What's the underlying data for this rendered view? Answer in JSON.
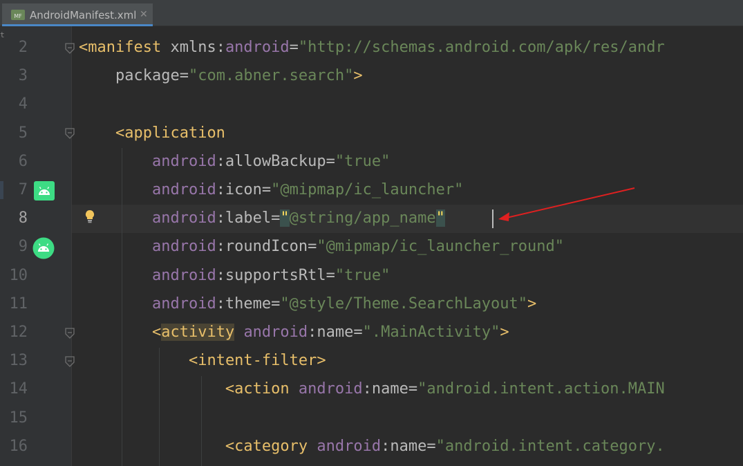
{
  "tab": {
    "icon_text": "MF",
    "label": "AndroidManifest.xml",
    "close": "✕"
  },
  "left_strip": {
    "glyph": "t"
  },
  "editor": {
    "top_fragment": "\"",
    "lines": [
      {
        "no": "2",
        "tokens": [
          {
            "c": "p",
            "t": "<"
          },
          {
            "c": "t",
            "t": "manifest"
          },
          {
            "c": "at",
            "t": " xmlns:"
          },
          {
            "c": "ns",
            "t": "android"
          },
          {
            "c": "at",
            "t": "="
          },
          {
            "c": "v",
            "t": "\"http://schemas.android.com/apk/res/andr"
          }
        ]
      },
      {
        "no": "3",
        "tokens": [
          {
            "c": "at",
            "t": "    package"
          },
          {
            "c": "at",
            "t": "="
          },
          {
            "c": "v",
            "t": "\"com.abner.search\""
          },
          {
            "c": "p",
            "t": ">"
          }
        ]
      },
      {
        "no": "4",
        "tokens": []
      },
      {
        "no": "5",
        "tokens": [
          {
            "c": "at",
            "t": "    "
          },
          {
            "c": "p",
            "t": "<"
          },
          {
            "c": "t",
            "t": "application"
          }
        ]
      },
      {
        "no": "6",
        "tokens": [
          {
            "c": "at",
            "t": "        "
          },
          {
            "c": "ns",
            "t": "android"
          },
          {
            "c": "at",
            "t": ":allowBackup="
          },
          {
            "c": "v",
            "t": "\"true\""
          }
        ]
      },
      {
        "no": "7",
        "tokens": [
          {
            "c": "at",
            "t": "        "
          },
          {
            "c": "ns",
            "t": "android"
          },
          {
            "c": "at",
            "t": ":icon="
          },
          {
            "c": "v",
            "t": "\"@mipmap/ic_launcher\""
          }
        ]
      },
      {
        "no": "8",
        "tokens": [
          {
            "c": "at",
            "t": "        "
          },
          {
            "c": "ns",
            "t": "android"
          },
          {
            "c": "at",
            "t": ":label="
          },
          {
            "c": "qm",
            "t": "\""
          },
          {
            "c": "v",
            "t": "@string/app_name"
          },
          {
            "c": "qm",
            "t": "\""
          }
        ]
      },
      {
        "no": "9",
        "tokens": [
          {
            "c": "at",
            "t": "        "
          },
          {
            "c": "ns",
            "t": "android"
          },
          {
            "c": "at",
            "t": ":roundIcon="
          },
          {
            "c": "v",
            "t": "\"@mipmap/ic_launcher_round\""
          }
        ]
      },
      {
        "no": "10",
        "tokens": [
          {
            "c": "at",
            "t": "        "
          },
          {
            "c": "ns",
            "t": "android"
          },
          {
            "c": "at",
            "t": ":supportsRtl="
          },
          {
            "c": "v",
            "t": "\"true\""
          }
        ]
      },
      {
        "no": "11",
        "tokens": [
          {
            "c": "at",
            "t": "        "
          },
          {
            "c": "ns",
            "t": "android"
          },
          {
            "c": "at",
            "t": ":theme="
          },
          {
            "c": "v",
            "t": "\"@style/Theme.SearchLayout\""
          },
          {
            "c": "p",
            "t": ">"
          }
        ]
      },
      {
        "no": "12",
        "tokens": [
          {
            "c": "at",
            "t": "        "
          },
          {
            "c": "p",
            "t": "<"
          },
          {
            "c": "hl-tag",
            "t": "activity"
          },
          {
            "c": "at",
            "t": " "
          },
          {
            "c": "ns",
            "t": "android"
          },
          {
            "c": "at",
            "t": ":name="
          },
          {
            "c": "v",
            "t": "\".MainActivity\""
          },
          {
            "c": "p",
            "t": ">"
          }
        ]
      },
      {
        "no": "13",
        "tokens": [
          {
            "c": "at",
            "t": "            "
          },
          {
            "c": "p",
            "t": "<"
          },
          {
            "c": "t",
            "t": "intent-filter"
          },
          {
            "c": "p",
            "t": ">"
          }
        ]
      },
      {
        "no": "14",
        "tokens": [
          {
            "c": "at",
            "t": "                "
          },
          {
            "c": "p",
            "t": "<"
          },
          {
            "c": "t",
            "t": "action"
          },
          {
            "c": "at",
            "t": " "
          },
          {
            "c": "ns",
            "t": "android"
          },
          {
            "c": "at",
            "t": ":name="
          },
          {
            "c": "v",
            "t": "\"android.intent.action.MAIN"
          }
        ]
      },
      {
        "no": "15",
        "tokens": []
      },
      {
        "no": "16",
        "tokens": [
          {
            "c": "at",
            "t": "                "
          },
          {
            "c": "p",
            "t": "<"
          },
          {
            "c": "t",
            "t": "category"
          },
          {
            "c": "at",
            "t": " "
          },
          {
            "c": "ns",
            "t": "android"
          },
          {
            "c": "at",
            "t": ":name="
          },
          {
            "c": "v",
            "t": "\"android.intent.category."
          }
        ]
      }
    ]
  },
  "colors": {
    "background": "#2b2b2b",
    "gutter": "#313335",
    "tag": "#e8bf6a",
    "namespace": "#9876aa",
    "attribute": "#bababa",
    "string": "#6a8759",
    "arrow": "#e02020",
    "android_icon": "#3ddc84"
  }
}
